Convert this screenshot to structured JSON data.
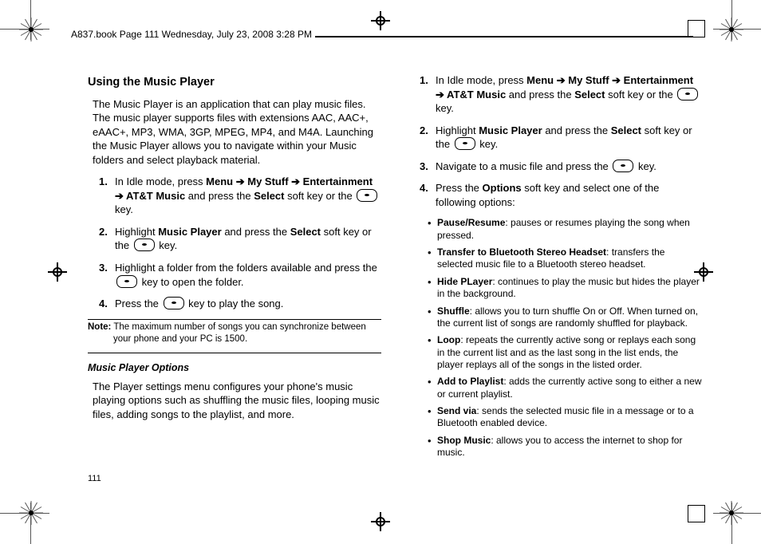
{
  "meta": {
    "file_header": "A837.book  Page 111  Wednesday, July 23, 2008  3:28 PM",
    "page_number": "111"
  },
  "left": {
    "h_using": "Using the Music Player",
    "intro": "The Music Player is an application that can play music files. The music player supports files with extensions AAC, AAC+, eAAC+, MP3, WMA, 3GP, MPEG, MP4, and M4A. Launching the Music Player allows you to navigate within your Music folders and select playback material.",
    "steps_label_1": "1.",
    "step1_a": "In Idle mode, press ",
    "step1_menu": "Menu",
    "step1_arrow": " ➔ ",
    "step1_mystuff": "My Stuff",
    "step1_ent": "Entertainment",
    "step1_att": "AT&T Music",
    "step1_mid": " and press the ",
    "step1_select": "Select",
    "step1_end": " soft key or the ",
    "step1_key_end": " key.",
    "steps_label_2": "2.",
    "step2_a": "Highlight ",
    "step2_mp": "Music Player",
    "step2_b": " and press the ",
    "step2_sel": "Select",
    "step2_c": " soft key or the ",
    "steps_label_3": "3.",
    "step3_a": "Highlight a folder from the folders available and press the ",
    "step3_b": " key to open the folder.",
    "steps_label_4": "4.",
    "step4_a": "Press the ",
    "step4_b": " key to play the song.",
    "note_label": "Note:",
    "note_body": " The maximum number of songs you can synchronize between your phone and your PC is 1500.",
    "h_mpo": "Music Player Options",
    "mpo_body": "The Player settings menu configures your phone's music playing options such as shuffling the music files, looping music files, adding songs to the playlist, and more."
  },
  "right": {
    "steps_label_1": "1.",
    "r_step1_a": "In Idle mode, press ",
    "r_step1_menu": "Menu",
    "r_step1_b": " and press the ",
    "r_step1_sel": "Select",
    "r_step1_c": " soft key or the ",
    "steps_label_2": "2.",
    "r_step2_a": "Highlight ",
    "r_step2_mp": "Music Player",
    "r_step2_b": " and press the ",
    "r_step2_sel": "Select",
    "r_step2_c": " soft key or the ",
    "steps_label_3": "3.",
    "r_step3_a": "Navigate to a music file and press the ",
    "r_step3_b": " key.",
    "steps_label_4": "4.",
    "r_step4_a": "Press the ",
    "r_step4_opt": "Options",
    "r_step4_b": " soft key and select one of the following options:",
    "opt1_b": "Pause/Resume",
    "opt1_t": ": pauses or resumes playing the song when pressed.",
    "opt2_b": "Transfer to Bluetooth Stereo Headset",
    "opt2_t": ": transfers the selected music file to a Bluetooth stereo headset.",
    "opt3_b": "Hide PLayer",
    "opt3_t": ": continues to play the music but hides the player in the background.",
    "opt4_b": "Shuffle",
    "opt4_t": ": allows you to turn shuffle On or Off. When turned on, the current list of songs are randomly shuffled for playback.",
    "opt5_b": "Loop",
    "opt5_t": ": repeats the currently active song or replays each song in the current list and as the last song in the list ends, the player replays all of the songs in the listed order.",
    "opt6_b": "Add to Playlist",
    "opt6_t": ": adds the currently active song to either a new or current playlist.",
    "opt7_b": "Send via",
    "opt7_t": ": sends the selected music file in a message or to a Bluetooth enabled device.",
    "opt8_b": "Shop Music",
    "opt8_t": ": allows you to access the internet to shop for music."
  }
}
